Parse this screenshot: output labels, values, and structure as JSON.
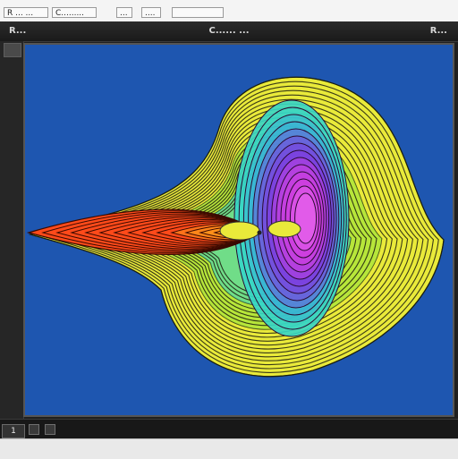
{
  "menubar": {
    "items": [
      {
        "label": "R ... ..."
      },
      {
        "label": "C........."
      },
      {
        "label": "..."
      },
      {
        "label": "...."
      }
    ]
  },
  "window": {
    "title_left": "R...",
    "title_center": "C...... ...",
    "title_right": "R..."
  },
  "statusbar": {
    "counter": "1"
  },
  "colors": {
    "background": "#1e56b0",
    "contour_outer": "#e9ea3a",
    "contour_mid": "#8ee23a",
    "contour_cyan": "#36d6c8",
    "lobe_purple": "#8a2be2",
    "lobe_magenta": "#e040e0",
    "jet_red": "#ff4a1a",
    "jet_orange": "#ff9a1a"
  },
  "icons": {
    "sidebar_handle": "grip-icon",
    "status_buttons": [
      "square-button-icon",
      "square-button-icon"
    ]
  }
}
